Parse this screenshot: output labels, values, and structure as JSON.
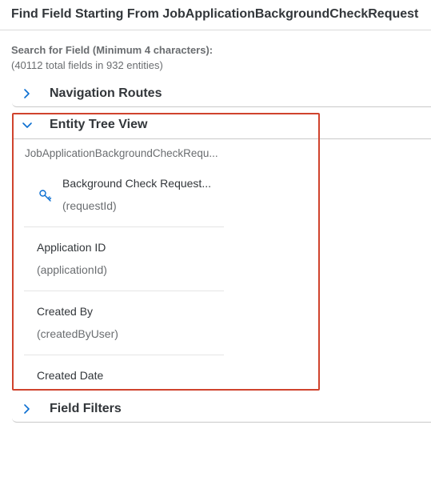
{
  "dialog": {
    "title": "Find Field Starting From JobApplicationBackgroundCheckRequest"
  },
  "search": {
    "hint": "Search for Field (Minimum 4 characters):",
    "count": "(40112 total fields in 932 entities)"
  },
  "panels": {
    "navigation_routes": {
      "label": "Navigation Routes",
      "icon": "chevron-right-icon"
    },
    "entity_tree_view": {
      "label": "Entity Tree View",
      "icon": "chevron-down-icon"
    },
    "field_filters": {
      "label": "Field Filters",
      "icon": "chevron-right-icon"
    }
  },
  "tree": {
    "root": "JobApplicationBackgroundCheckRequ...",
    "items": [
      {
        "name": "Background Check Request...",
        "id": "(requestId)",
        "icon": "key-icon"
      },
      {
        "name": "Application ID",
        "id": "(applicationId)"
      },
      {
        "name": "Created By",
        "id": "(createdByUser)"
      },
      {
        "name": "Created Date",
        "id": ""
      }
    ]
  },
  "colors": {
    "accent": "#0a6ed1",
    "highlight": "#d0432d",
    "text": "#32363a",
    "muted": "#6a6d70"
  }
}
